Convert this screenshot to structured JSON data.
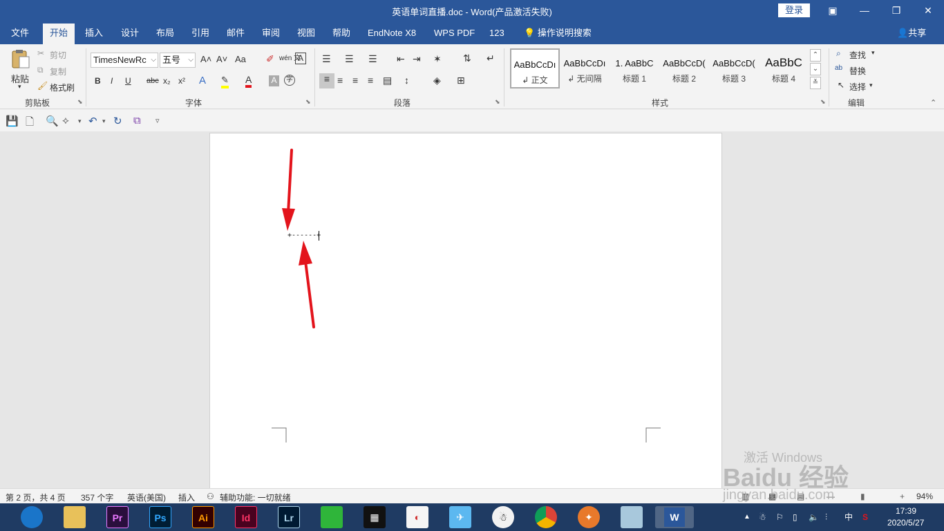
{
  "titlebar": {
    "doc_title": "英语单词直播.doc  -  Word(产品激活失败)",
    "login": "登录",
    "ribbon_options": "▣",
    "minimize": "—",
    "restore": "❐",
    "close": "✕"
  },
  "tabs": [
    {
      "label": "文件"
    },
    {
      "label": "开始"
    },
    {
      "label": "插入"
    },
    {
      "label": "设计"
    },
    {
      "label": "布局"
    },
    {
      "label": "引用"
    },
    {
      "label": "邮件"
    },
    {
      "label": "审阅"
    },
    {
      "label": "视图"
    },
    {
      "label": "帮助"
    },
    {
      "label": "EndNote X8"
    },
    {
      "label": "WPS PDF"
    },
    {
      "label": "123"
    }
  ],
  "tellme": "操作说明搜索",
  "share": "共享",
  "clipboard": {
    "group_label": "剪贴板",
    "paste": "粘贴",
    "cut": "剪切",
    "copy": "复制",
    "format_painter": "格式刷"
  },
  "font": {
    "group_label": "字体",
    "font_name": "TimesNewRc",
    "font_size": "五号",
    "bold": "B",
    "italic": "I",
    "underline": "U",
    "strike": "abc",
    "subscript": "x₂",
    "superscript": "x²",
    "change_case": "Aa",
    "grow": "A˄",
    "shrink": "A˅",
    "wen": "wén 文",
    "box_a": "A"
  },
  "paragraph": {
    "group_label": "段落"
  },
  "styles": {
    "group_label": "样式",
    "items": [
      {
        "sample": "AaBbCcDı",
        "name": "↲ 正文"
      },
      {
        "sample": "AaBbCcDı",
        "name": "↲ 无间隔"
      },
      {
        "sample": "1.  AaBbC",
        "name": "标题 1"
      },
      {
        "sample": "AaBbCcD(",
        "name": "标题 2"
      },
      {
        "sample": "AaBbCcD(",
        "name": "标题 3"
      },
      {
        "sample": "AaBbC",
        "name": "标题 4"
      }
    ]
  },
  "editing": {
    "group_label": "编辑",
    "find": "查找",
    "replace": "替换",
    "select": "选择"
  },
  "document": {
    "text": "+------+"
  },
  "statusbar": {
    "page": "第 2 页，共 4 页",
    "words": "357 个字",
    "language": "英语(美国)",
    "insert_mode": "插入",
    "accessibility": "辅助功能: 一切就绪",
    "zoom": "94%"
  },
  "taskbar": {
    "apps": [
      {
        "label": "Pr"
      },
      {
        "label": "Ps"
      },
      {
        "label": "Ai"
      },
      {
        "label": "Id"
      },
      {
        "label": "Lr"
      },
      {
        "label": "W"
      }
    ],
    "ime": "中",
    "time": "17:39",
    "date": "2020/5/27"
  },
  "watermark": {
    "activate": "激活 Windows",
    "brand": "Baidu 经验",
    "url": "jingyan.baidu.com"
  },
  "colors": {
    "brand_blue": "#2b579a",
    "arrow_red": "#e3141c"
  }
}
